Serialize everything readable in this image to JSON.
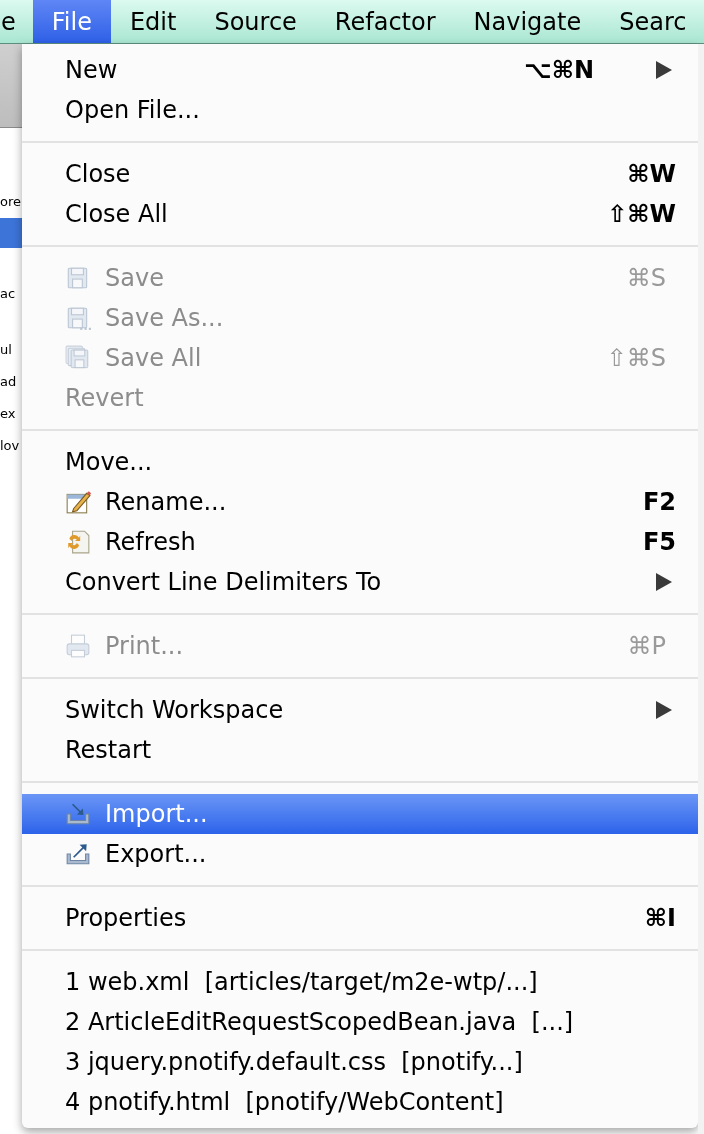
{
  "menu_bar": {
    "items": [
      {
        "label": "e",
        "selected": false
      },
      {
        "label": "File",
        "selected": true
      },
      {
        "label": "Edit",
        "selected": false
      },
      {
        "label": "Source",
        "selected": false
      },
      {
        "label": "Refactor",
        "selected": false
      },
      {
        "label": "Navigate",
        "selected": false
      },
      {
        "label": "Searc",
        "selected": false
      }
    ]
  },
  "side_panel": {
    "rows": [
      {
        "kind": "text",
        "text": "ore"
      },
      {
        "kind": "highlight"
      },
      {
        "kind": "text",
        "text": "ac"
      },
      {
        "kind": "text",
        "text": "ul"
      },
      {
        "kind": "text",
        "text": "ad"
      },
      {
        "kind": "text",
        "text": "ex"
      },
      {
        "kind": "text",
        "text": "lov"
      }
    ]
  },
  "menu": {
    "items": [
      {
        "kind": "item",
        "label": "New",
        "shortcut": "⌥⌘N",
        "submenu": true,
        "disabled": false,
        "selected": false
      },
      {
        "kind": "item",
        "label": "Open File...",
        "disabled": false,
        "selected": false
      },
      {
        "kind": "separator"
      },
      {
        "kind": "item",
        "label": "Close",
        "shortcut": "⌘W",
        "disabled": false,
        "selected": false
      },
      {
        "kind": "item",
        "label": "Close All",
        "shortcut": "⇧⌘W",
        "disabled": false,
        "selected": false
      },
      {
        "kind": "separator"
      },
      {
        "kind": "item",
        "label": "Save",
        "shortcut": "⌘S",
        "disabled": true,
        "selected": false
      },
      {
        "kind": "item",
        "label": "Save As...",
        "disabled": true,
        "selected": false
      },
      {
        "kind": "item",
        "label": "Save All",
        "shortcut": "⇧⌘S",
        "disabled": true,
        "selected": false
      },
      {
        "kind": "item",
        "label": "Revert",
        "disabled": true,
        "selected": false
      },
      {
        "kind": "separator"
      },
      {
        "kind": "item",
        "label": "Move...",
        "disabled": false,
        "selected": false
      },
      {
        "kind": "item",
        "label": "Rename...",
        "shortcut": "F2",
        "disabled": false,
        "selected": false
      },
      {
        "kind": "item",
        "label": "Refresh",
        "shortcut": "F5",
        "disabled": false,
        "selected": false
      },
      {
        "kind": "item",
        "label": "Convert Line Delimiters To",
        "submenu": true,
        "disabled": false,
        "selected": false
      },
      {
        "kind": "separator"
      },
      {
        "kind": "item",
        "label": "Print...",
        "shortcut": "⌘P",
        "disabled": true,
        "selected": false
      },
      {
        "kind": "separator"
      },
      {
        "kind": "item",
        "label": "Switch Workspace",
        "submenu": true,
        "disabled": false,
        "selected": false
      },
      {
        "kind": "item",
        "label": "Restart",
        "disabled": false,
        "selected": false
      },
      {
        "kind": "separator"
      },
      {
        "kind": "item",
        "label": "Import...",
        "disabled": false,
        "selected": true
      },
      {
        "kind": "item",
        "label": "Export...",
        "disabled": false,
        "selected": false
      },
      {
        "kind": "separator"
      },
      {
        "kind": "item",
        "label": "Properties",
        "shortcut": "⌘I",
        "disabled": false,
        "selected": false
      },
      {
        "kind": "separator"
      },
      {
        "kind": "recent",
        "label": "1 web.xml  [articles/target/m2e-wtp/...]",
        "disabled": false,
        "selected": false
      },
      {
        "kind": "recent",
        "label": "2 ArticleEditRequestScopedBean.java  [...]",
        "disabled": false,
        "selected": false
      },
      {
        "kind": "recent",
        "label": "3 jquery.pnotify.default.css  [pnotify...]",
        "disabled": false,
        "selected": false
      },
      {
        "kind": "recent",
        "label": "4 pnotify.html  [pnotify/WebContent]",
        "disabled": false,
        "selected": false
      }
    ]
  }
}
